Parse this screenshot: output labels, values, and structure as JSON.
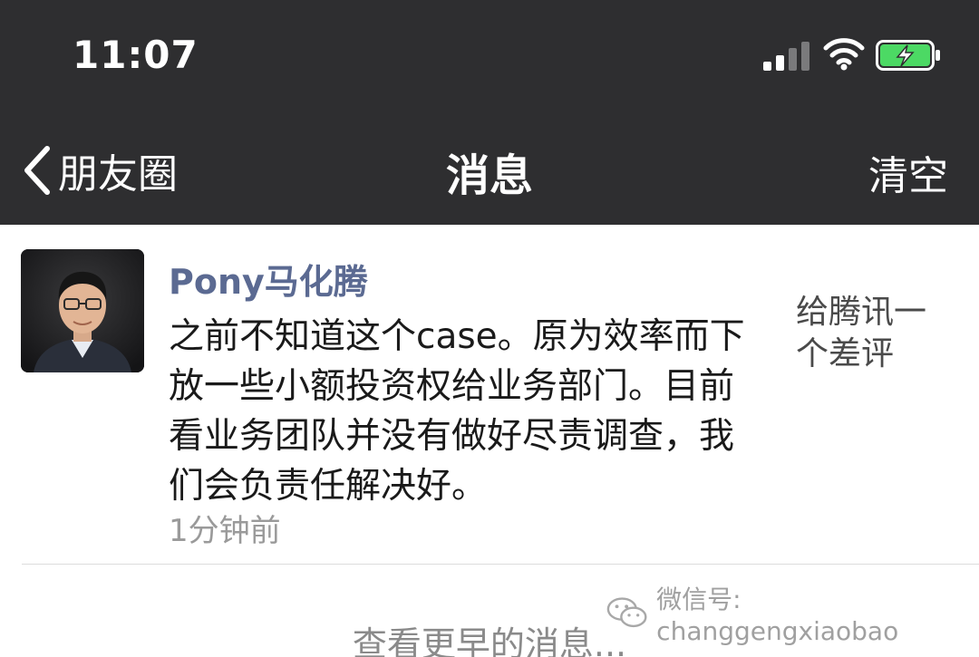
{
  "status_bar": {
    "time": "11:07",
    "icons": [
      "signal-icon",
      "wifi-icon",
      "battery-charging-icon"
    ]
  },
  "nav": {
    "back_label": "朋友圈",
    "title": "消息",
    "right_action": "清空"
  },
  "message": {
    "sender": "Pony马化腾",
    "text": "之前不知道这个case。原为效率而下放一些小额投资权给业务部门。目前看业务团队并没有做好尽责调查，我们会负责任解决好。",
    "time": "1分钟前",
    "post_preview": "给腾讯一个差评"
  },
  "footer": {
    "earlier_label": "查看更早的消息..."
  },
  "watermark": {
    "text": "微信号: changgengxiaobao"
  },
  "colors": {
    "header_bg": "#2e2e30",
    "sender_name": "#5b6a92",
    "battery_fill": "#4cd964"
  }
}
